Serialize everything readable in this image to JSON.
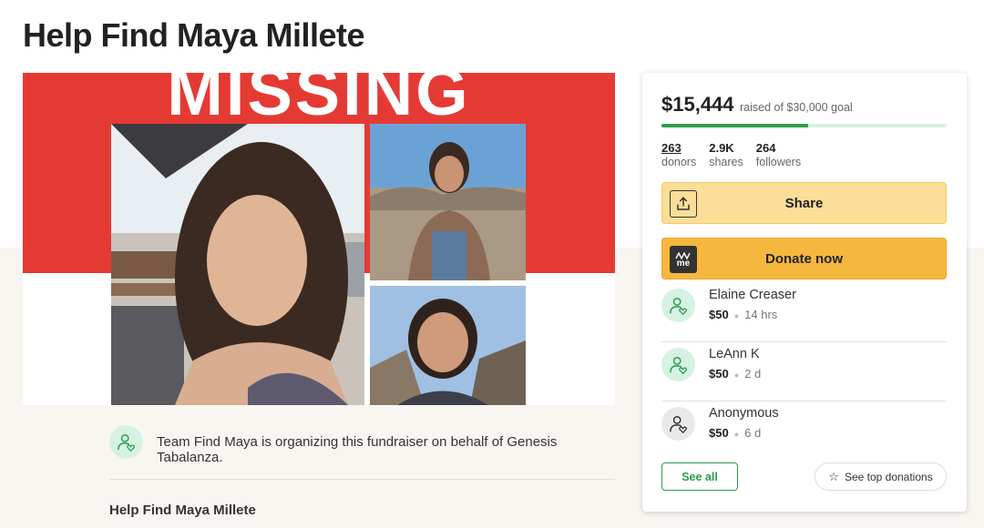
{
  "page": {
    "title": "Help Find Maya Millete"
  },
  "hero": {
    "headline": "MISSING"
  },
  "organizer": {
    "text": "Team Find Maya is organizing this fundraiser on behalf of Genesis Tabalanza."
  },
  "story": {
    "title": "Help Find Maya Millete"
  },
  "donation": {
    "raised": "$15,444",
    "goal_text": "raised of $30,000 goal",
    "progress_fraction": 0.515,
    "stats": [
      {
        "value": "263",
        "label": "donors"
      },
      {
        "value": "2.9K",
        "label": "shares"
      },
      {
        "value": "264",
        "label": "followers"
      }
    ],
    "share_label": "Share",
    "donate_label": "Donate now",
    "donate_icon_text": "me",
    "donors": [
      {
        "name": "Elaine Creaser",
        "amount": "$50",
        "time": "14 hrs"
      },
      {
        "name": "LeAnn K",
        "amount": "$50",
        "time": "2 d"
      },
      {
        "name": "Anonymous",
        "amount": "$50",
        "time": "6 d"
      }
    ],
    "see_all_label": "See all",
    "top_donations_label": "See top donations"
  },
  "colors": {
    "accent_green": "#2b9d4c",
    "share_yellow": "#fbde97",
    "donate_orange": "#f6b73f",
    "poster_red": "#e53a34"
  },
  "icons": {
    "share": "upload-icon",
    "donate": "gofundme-icon",
    "donor": "user-heart-icon",
    "star": "star-icon"
  }
}
